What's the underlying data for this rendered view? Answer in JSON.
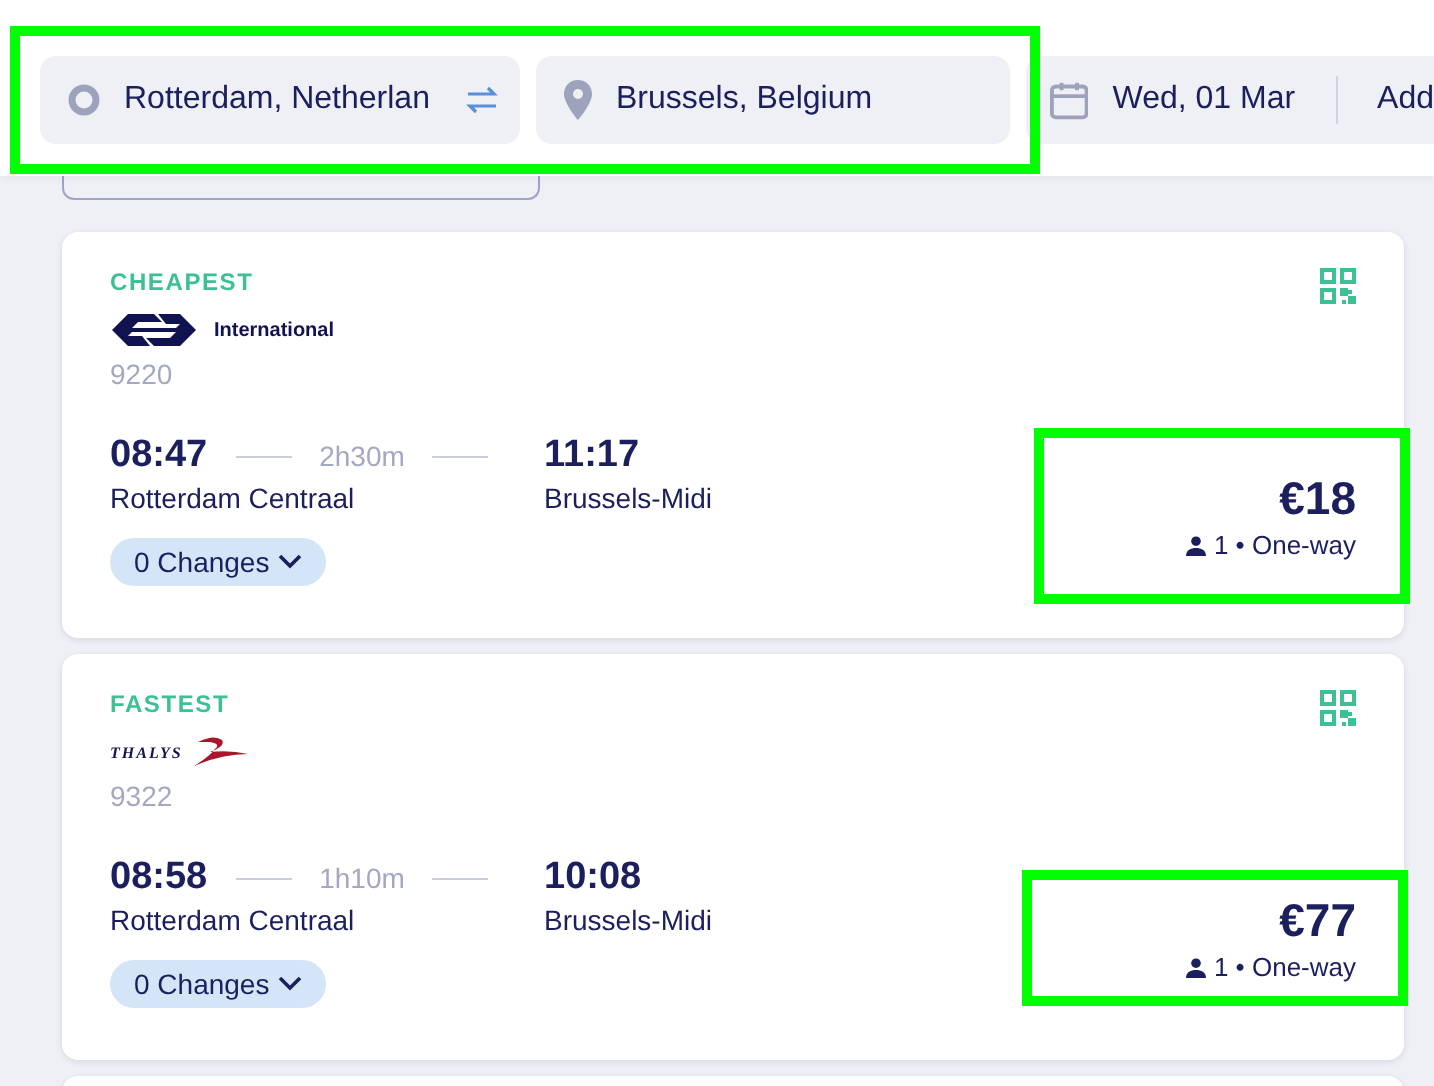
{
  "search": {
    "origin": "Rotterdam, Netherlan",
    "destination": "Brussels, Belgium",
    "date": "Wed, 01 Mar",
    "extra": "Add",
    "highlighted": true
  },
  "results": [
    {
      "tag": "CHEAPEST",
      "operator": {
        "kind": "arrows",
        "text": "International"
      },
      "train": "9220",
      "depart": "08:47",
      "duration": "2h30m",
      "arrive": "11:17",
      "from": "Rotterdam Centraal",
      "to": "Brussels-Midi",
      "changes": "0 Changes",
      "price": "€18",
      "passengers": "1 • One-way",
      "highlighted": true
    },
    {
      "tag": "FASTEST",
      "operator": {
        "kind": "swoosh",
        "text": "THALYS"
      },
      "train": "9322",
      "depart": "08:58",
      "duration": "1h10m",
      "arrive": "10:08",
      "from": "Rotterdam Centraal",
      "to": "Brussels-Midi",
      "changes": "0 Changes",
      "price": "€77",
      "passengers": "1 • One-way",
      "highlighted": true
    }
  ]
}
